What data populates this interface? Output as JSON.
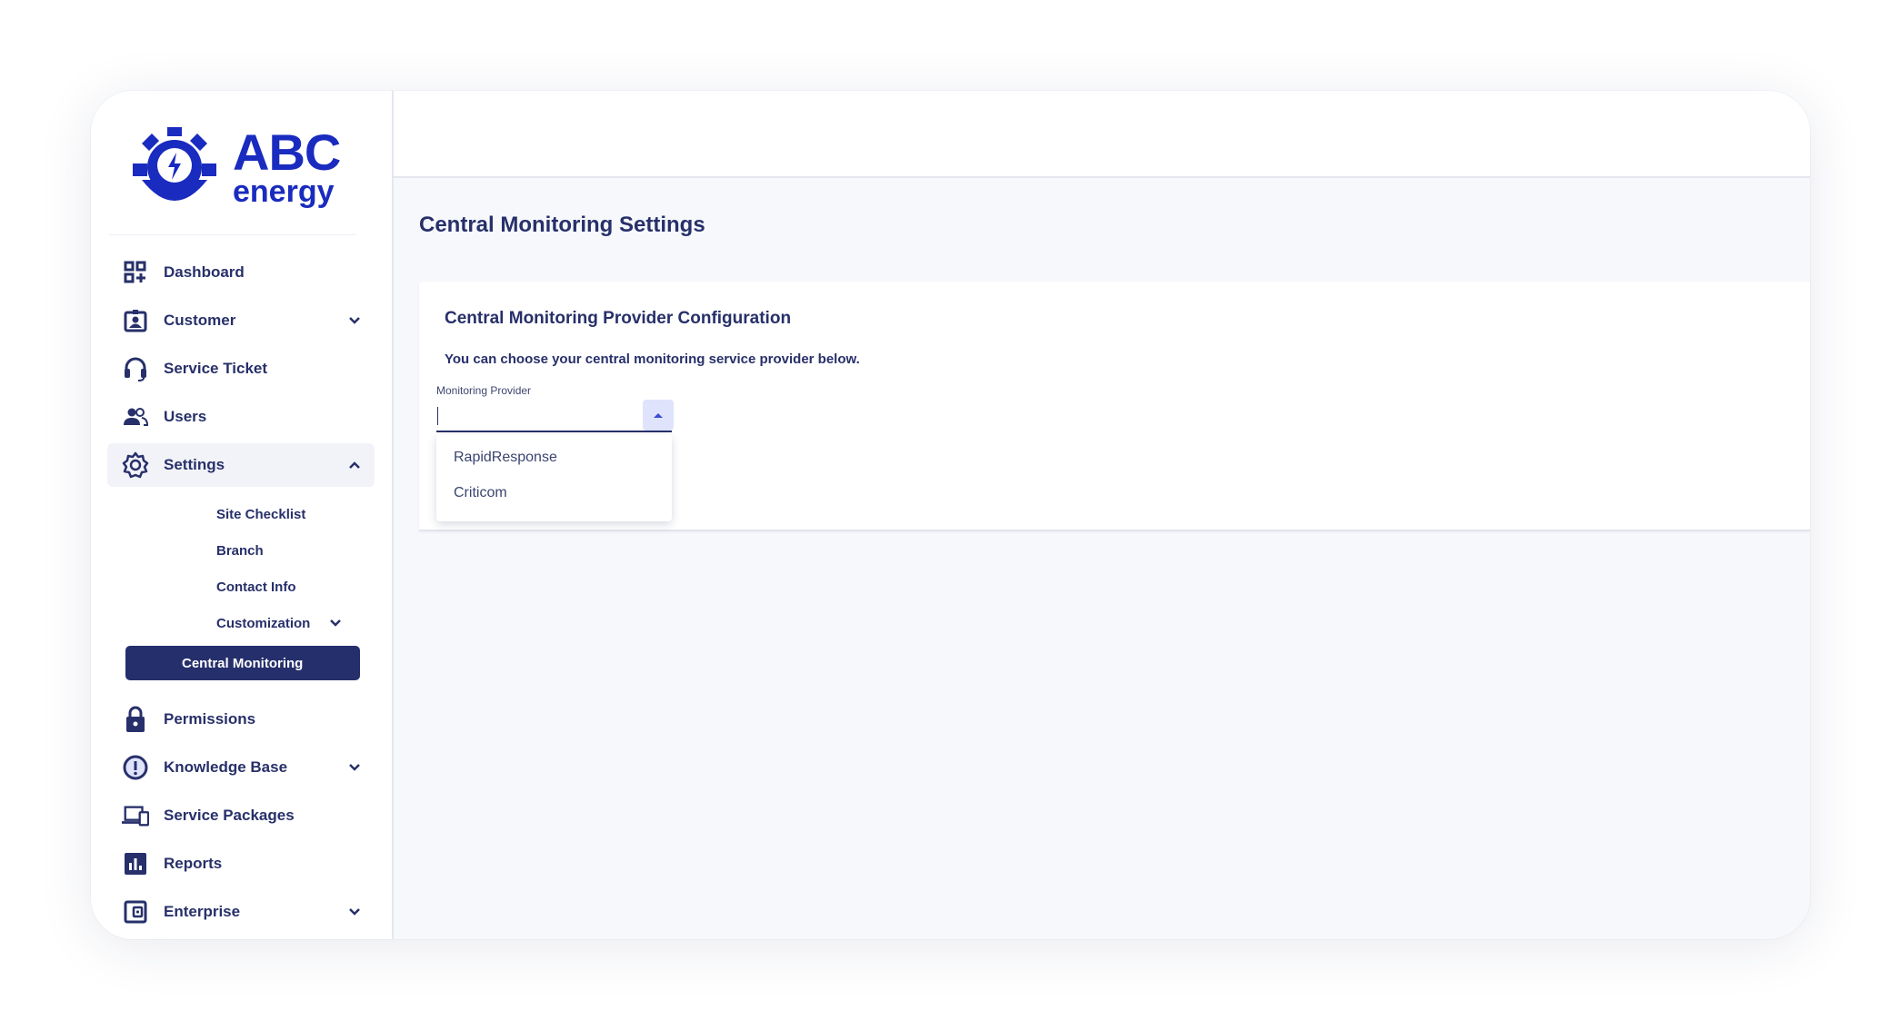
{
  "brand": {
    "name": "ABC",
    "tagline": "energy",
    "color": "#1a2bbf"
  },
  "sidebar": {
    "items": [
      {
        "label": "Dashboard",
        "icon": "dashboard-icon"
      },
      {
        "label": "Customer",
        "icon": "id-badge-icon",
        "expandable": true
      },
      {
        "label": "Service Ticket",
        "icon": "headset-icon"
      },
      {
        "label": "Users",
        "icon": "users-icon"
      },
      {
        "label": "Settings",
        "icon": "gear-icon",
        "expanded": true
      },
      {
        "label": "Permissions",
        "icon": "lock-icon"
      },
      {
        "label": "Knowledge Base",
        "icon": "info-circle-icon",
        "expandable": true
      },
      {
        "label": "Service Packages",
        "icon": "devices-icon"
      },
      {
        "label": "Reports",
        "icon": "bar-chart-icon"
      },
      {
        "label": "Enterprise",
        "icon": "wallet-icon",
        "expandable": true
      }
    ],
    "settings_sub": [
      {
        "label": "Site Checklist"
      },
      {
        "label": "Branch"
      },
      {
        "label": "Contact Info"
      },
      {
        "label": "Customization",
        "expandable": true
      },
      {
        "label": "Central Monitoring",
        "active": true
      }
    ],
    "active_color": "#252f6b"
  },
  "main": {
    "page_title": "Central Monitoring Settings",
    "card": {
      "title": "Central Monitoring Provider Configuration",
      "description": "You can choose your central monitoring service provider below.",
      "field": {
        "label": "Monitoring Provider",
        "value": "",
        "options": [
          "RapidResponse",
          "Criticom"
        ]
      }
    }
  }
}
